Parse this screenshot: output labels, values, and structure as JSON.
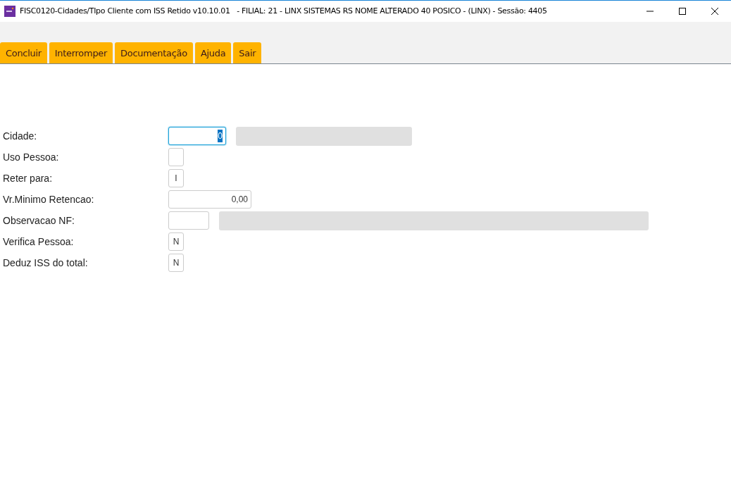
{
  "window": {
    "title": "FISC0120-Cidades/TIpo Cliente com ISS Retido v10.10.01   - FILIAL: 21 - LINX SISTEMAS RS NOME ALTERADO 40 POSICO - (LINX) - Sessão: 4405"
  },
  "toolbar": {
    "buttons": [
      "Concluir",
      "Interromper",
      "Documentação",
      "Ajuda",
      "Sair"
    ]
  },
  "form": {
    "fields": [
      {
        "label": "Cidade:",
        "kind": "code",
        "value": "0",
        "focused": true,
        "lookup_field": {
          "disabled": true,
          "kind": "short"
        }
      },
      {
        "label": "Uso Pessoa:",
        "kind": "flag",
        "focused": false
      },
      {
        "label": "Reter para:",
        "kind": "flag",
        "value": "I",
        "focused": false
      },
      {
        "label": "Vr.Minimo Retencao:",
        "kind": "amount",
        "value": "0,00",
        "focused": false
      },
      {
        "label": "Observacao NF:",
        "kind": "text",
        "focused": false,
        "lookup_field": {
          "disabled": true,
          "kind": "long"
        }
      },
      {
        "label": "Verifica Pessoa:",
        "kind": "flag",
        "value": "N",
        "focused": false
      },
      {
        "label": "Deduz ISS do total:",
        "kind": "flag",
        "value": "N",
        "focused": false
      }
    ]
  }
}
